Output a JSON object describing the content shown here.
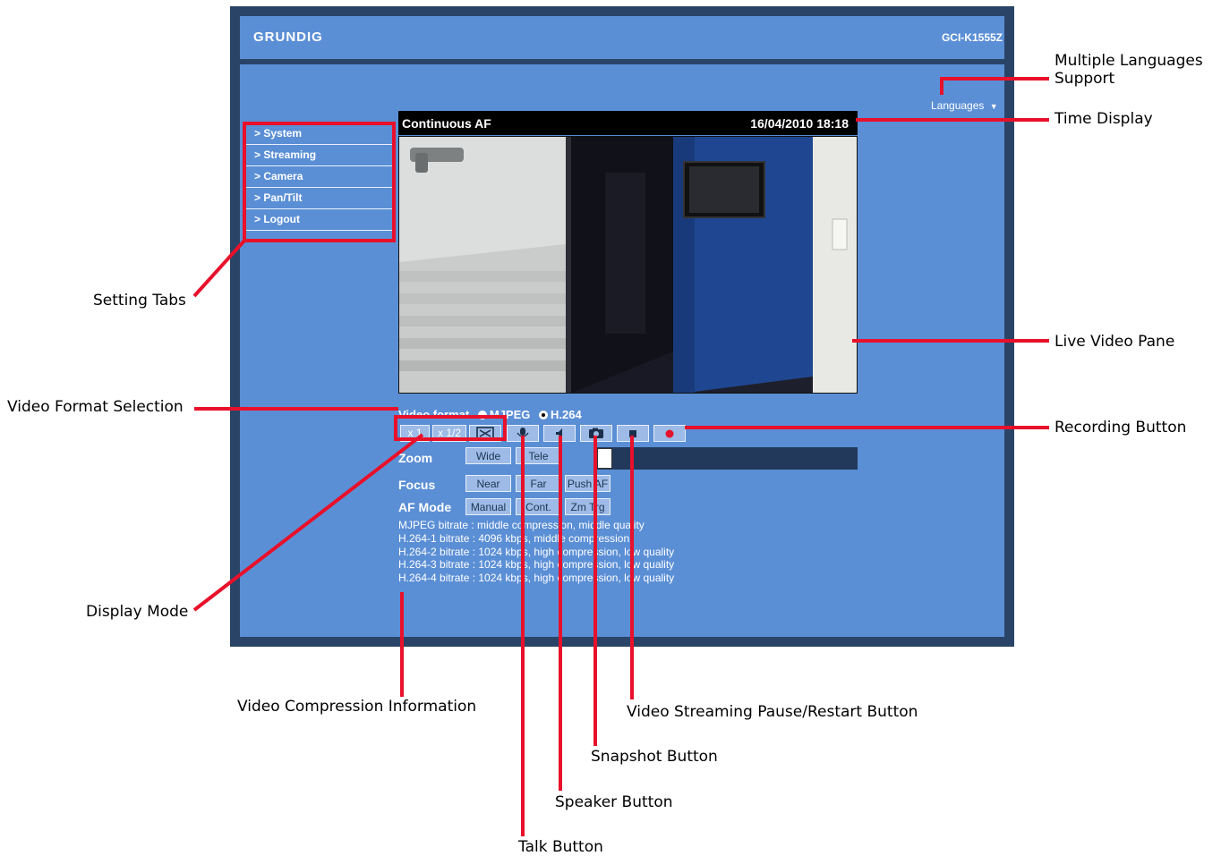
{
  "header": {
    "brand": "GRUNDIG",
    "model": "GCI-K1555Z"
  },
  "languages": {
    "label": "Languages",
    "arrow": "▼"
  },
  "tabs": [
    {
      "label": "> System"
    },
    {
      "label": "> Streaming"
    },
    {
      "label": "> Camera"
    },
    {
      "label": "> Pan/Tilt"
    },
    {
      "label": "> Logout"
    }
  ],
  "video": {
    "mode_label": "Continuous AF",
    "timestamp": "16/04/2010 18:18"
  },
  "video_format": {
    "label": "Video format",
    "options": [
      "MJPEG",
      "H.264"
    ],
    "selected": "H.264"
  },
  "display_mode": {
    "buttons": [
      "x 1",
      "x 1/2"
    ],
    "fullscreen_icon": "fullscreen-icon"
  },
  "toolbar_icons": [
    "microphone-icon",
    "speaker-icon",
    "camera-icon",
    "stop-icon",
    "record-icon"
  ],
  "controls": {
    "zoom": {
      "label": "Zoom",
      "buttons": [
        "Wide",
        "Tele"
      ]
    },
    "focus": {
      "label": "Focus",
      "buttons": [
        "Near",
        "Far",
        "Push AF"
      ]
    },
    "af_mode": {
      "label": "AF Mode",
      "buttons": [
        "Manual",
        "Cont.",
        "Zm Trg"
      ]
    }
  },
  "compression_info": [
    "MJPEG bitrate : middle compression, middle quality",
    "H.264-1 bitrate : 4096 kbps, middle compression",
    "H.264-2 bitrate : 1024 kbps, high compression, low quality",
    "H.264-3 bitrate : 1024 kbps, high compression, low quality",
    "H.264-4 bitrate : 1024 kbps, high compression, low quality"
  ],
  "callouts": {
    "languages": [
      "Multiple Languages",
      "Support"
    ],
    "time": "Time Display",
    "tabs": "Setting Tabs",
    "live": "Live Video Pane",
    "format": "Video Format Selection",
    "recording": "Recording Button",
    "display": "Display Mode",
    "compression": "Video Compression Information",
    "pause": "Video Streaming Pause/Restart Button",
    "snapshot": "Snapshot Button",
    "speaker": "Speaker Button",
    "talk": "Talk Button"
  },
  "colors": {
    "frame": "#2a4468",
    "panel": "#5b8fd5",
    "callout": "#e8102a"
  }
}
